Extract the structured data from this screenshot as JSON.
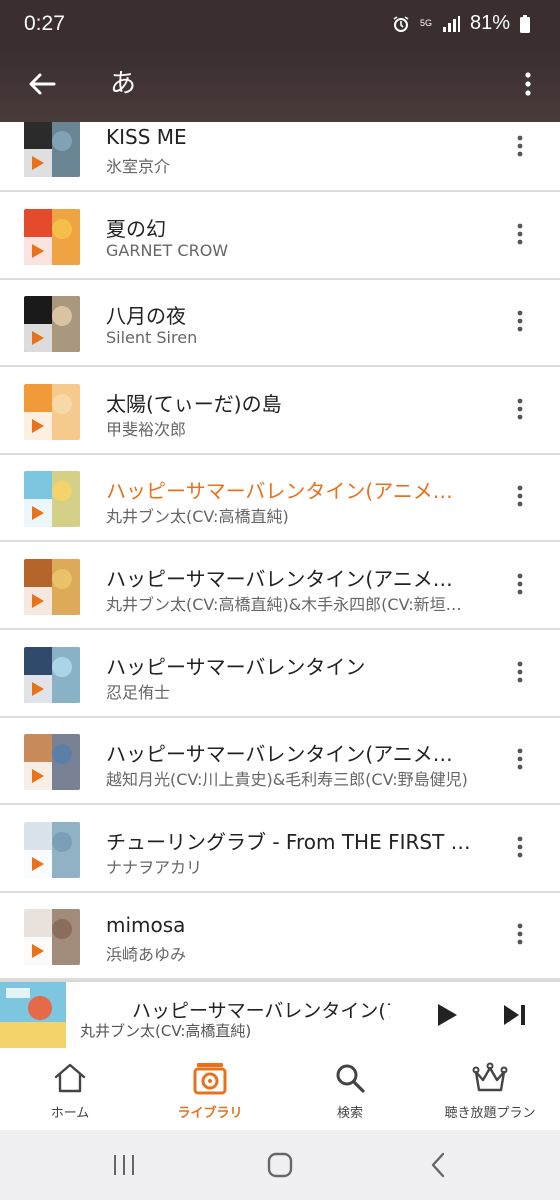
{
  "status": {
    "time": "0:27",
    "network": "5G",
    "battery": "81%"
  },
  "header": {
    "title": "あ"
  },
  "tracks": [
    {
      "title": "KISS ME",
      "artist": "氷室京介",
      "active": false,
      "art": [
        "#2b2b2b",
        "#7fa3b5"
      ]
    },
    {
      "title": "夏の幻",
      "artist": "GARNET CROW",
      "active": false,
      "art": [
        "#e44b2c",
        "#f4c04a"
      ]
    },
    {
      "title": "八月の夜",
      "artist": "Silent Siren",
      "active": false,
      "art": [
        "#1a1a1a",
        "#d9c3a0"
      ]
    },
    {
      "title": "太陽(てぃーだ)の島",
      "artist": "甲斐裕次郎",
      "active": false,
      "art": [
        "#f19a3a",
        "#f7d9a8"
      ]
    },
    {
      "title": "ハッピーサマーバレンタイン(アニメ…",
      "artist": "丸井ブン太(CV:高橋直純)",
      "active": true,
      "art": [
        "#7cc6e0",
        "#f3d36a"
      ]
    },
    {
      "title": "ハッピーサマーバレンタイン(アニメ…",
      "artist": "丸井ブン太(CV:高橋直純)&木手永四郎(CV:新垣…",
      "active": false,
      "art": [
        "#b5642a",
        "#e9c26a"
      ]
    },
    {
      "title": "ハッピーサマーバレンタイン",
      "artist": "忍足侑士",
      "active": false,
      "art": [
        "#2f4a6a",
        "#a9d5e6"
      ]
    },
    {
      "title": "ハッピーサマーバレンタイン(アニメ…",
      "artist": "越知月光(CV:川上貴史)&毛利寿三郎(CV:野島健児)",
      "active": false,
      "art": [
        "#c98b5a",
        "#5c7fa8"
      ]
    },
    {
      "title": "チューリングラブ - From THE FIRST …",
      "artist": "ナナヲアカリ",
      "active": false,
      "art": [
        "#d8e3ec",
        "#7aa0b8"
      ]
    },
    {
      "title": "mimosa",
      "artist": "浜崎あゆみ",
      "active": false,
      "art": [
        "#e9e2dc",
        "#8a6d5a"
      ]
    }
  ],
  "mini_player": {
    "title": "ハッピーサマーバレンタイン(ア",
    "artist": "丸井ブン太(CV:高橋直純)"
  },
  "bottom_nav": [
    {
      "label": "ホーム",
      "icon": "home-icon",
      "active": false
    },
    {
      "label": "ライブラリ",
      "icon": "library-icon",
      "active": true
    },
    {
      "label": "検索",
      "icon": "search-icon",
      "active": false
    },
    {
      "label": "聴き放題プラン",
      "icon": "crown-icon",
      "active": false
    }
  ],
  "colors": {
    "accent": "#e8711a",
    "header_bg": "#3a2e2e"
  }
}
